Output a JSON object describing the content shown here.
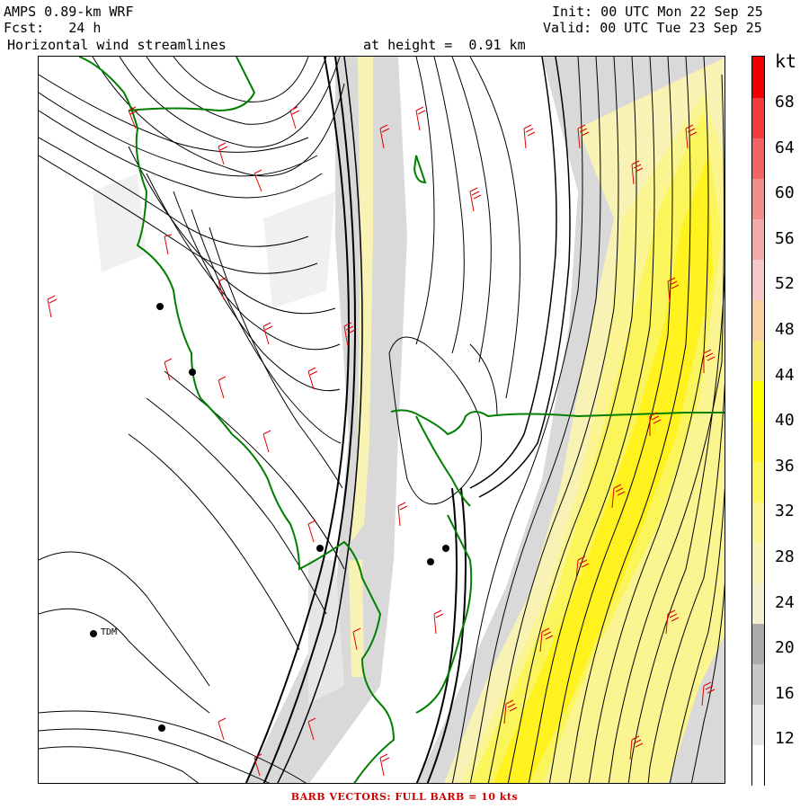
{
  "header": {
    "model": "AMPS 0.89-km WRF",
    "forecast": "Fcst:   24 h",
    "product": "Horizontal wind streamlines",
    "height": "at height =  0.91 km",
    "init": "Init: 00 UTC Mon 22 Sep 25",
    "valid": "Valid: 00 UTC Tue 23 Sep 25"
  },
  "legend": {
    "unit": "kt",
    "labels": [
      "68",
      "64",
      "60",
      "56",
      "52",
      "48",
      "44",
      "40",
      "36",
      "32",
      "28",
      "24",
      "20",
      "16",
      "12"
    ],
    "colors": [
      "#ffffff",
      "#e6e6e6",
      "#c8c8c8",
      "#aaaaaa",
      "#f5f0d2",
      "#f8f3b4",
      "#faf590",
      "#fbf55c",
      "#fff21e",
      "#ffff00",
      "#f5e678",
      "#f7d2a0",
      "#f5c8c8",
      "#f3aaaa",
      "#f48c8c",
      "#f46464",
      "#f23c3c",
      "#ee0000"
    ],
    "colors_order": "bottom-to-top"
  },
  "map": {
    "stations": [
      {
        "label": ""
      },
      {
        "label": ""
      },
      {
        "label": ""
      },
      {
        "label": ""
      },
      {
        "label": ""
      },
      {
        "label": "TDM"
      },
      {
        "label": ""
      }
    ],
    "colors": {
      "coast": "#008000",
      "barbs": "#e00000",
      "streamlines": "#000000"
    }
  },
  "footer": "BARB VECTORS:  FULL BARB = 10 kts"
}
